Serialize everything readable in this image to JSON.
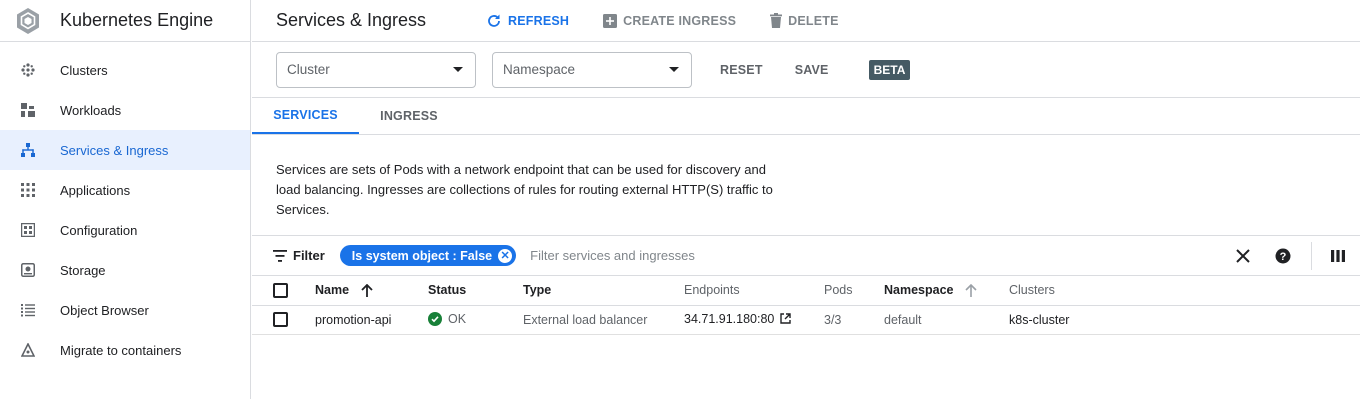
{
  "sidebar": {
    "title": "Kubernetes Engine",
    "items": [
      {
        "label": "Clusters",
        "icon": "clusters-icon"
      },
      {
        "label": "Workloads",
        "icon": "workloads-icon"
      },
      {
        "label": "Services & Ingress",
        "icon": "services-icon",
        "active": true
      },
      {
        "label": "Applications",
        "icon": "applications-icon"
      },
      {
        "label": "Configuration",
        "icon": "configuration-icon"
      },
      {
        "label": "Storage",
        "icon": "storage-icon"
      },
      {
        "label": "Object Browser",
        "icon": "object-browser-icon"
      },
      {
        "label": "Migrate to containers",
        "icon": "migrate-icon"
      }
    ]
  },
  "header": {
    "title": "Services & Ingress",
    "refresh_label": "REFRESH",
    "create_label": "CREATE INGRESS",
    "delete_label": "DELETE"
  },
  "filters": {
    "cluster_placeholder": "Cluster",
    "namespace_placeholder": "Namespace",
    "reset_label": "RESET",
    "save_label": "SAVE",
    "beta_label": "BETA"
  },
  "tabs": [
    {
      "label": "SERVICES",
      "active": true
    },
    {
      "label": "INGRESS",
      "active": false
    }
  ],
  "description": "Services are sets of Pods with a network endpoint that can be used for discovery and load balancing. Ingresses are collections of rules for routing external HTTP(S) traffic to Services.",
  "table_filter": {
    "label": "Filter",
    "chip": "Is system object : False",
    "placeholder": "Filter services and ingresses"
  },
  "table": {
    "columns": [
      "Name",
      "Status",
      "Type",
      "Endpoints",
      "Pods",
      "Namespace",
      "Clusters"
    ],
    "rows": [
      {
        "name": "promotion-api",
        "status": "OK",
        "type": "External load balancer",
        "endpoints": "34.71.91.180:80",
        "pods": "3/3",
        "namespace": "default",
        "clusters": "k8s-cluster"
      }
    ]
  },
  "colors": {
    "accent": "#1a73e8",
    "active_bg": "#e8f0fe",
    "ok": "#188038",
    "beta_bg": "#455a64"
  }
}
